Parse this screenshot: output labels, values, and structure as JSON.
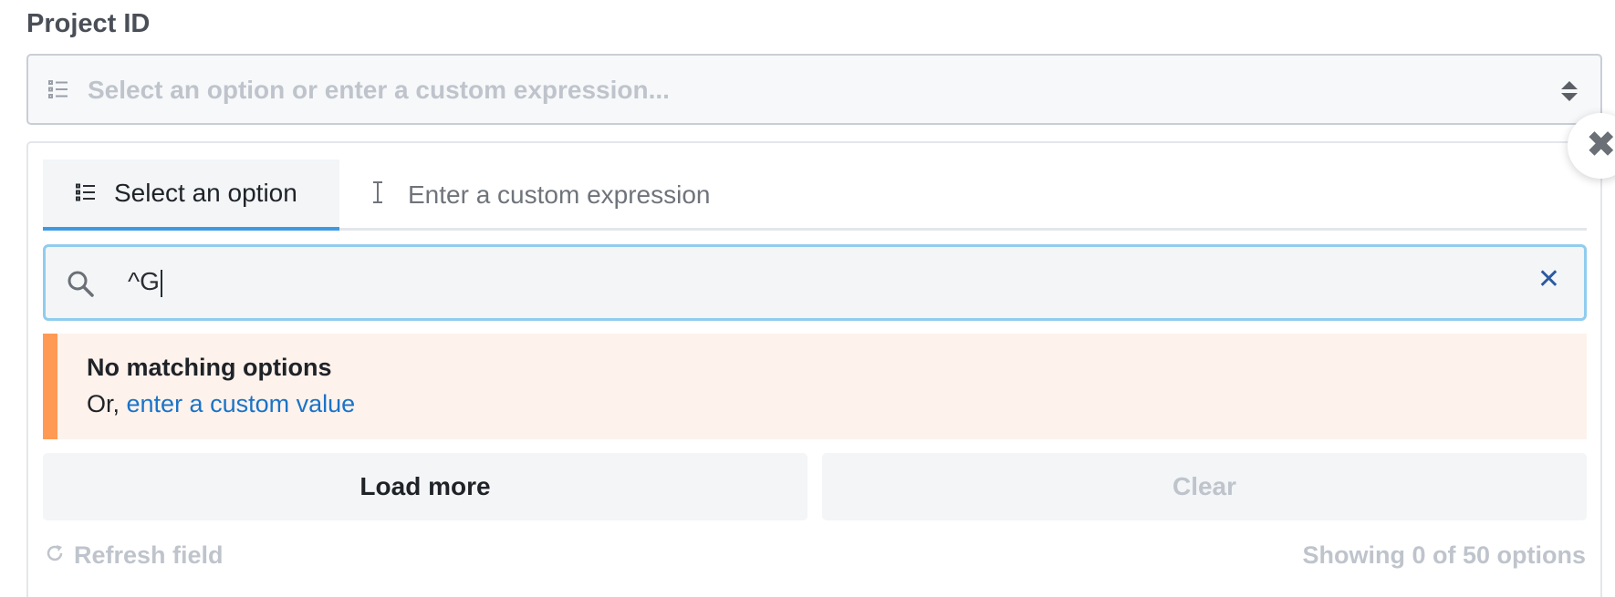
{
  "field": {
    "label": "Project ID",
    "placeholder": "Select an option or enter a custom expression..."
  },
  "tabs": [
    {
      "label": "Select an option",
      "active": true,
      "icon": "list-icon"
    },
    {
      "label": "Enter a custom expression",
      "active": false,
      "icon": "text-cursor-icon"
    }
  ],
  "search": {
    "value": "^G",
    "clear_glyph": "✕"
  },
  "notice": {
    "title": "No matching options",
    "prefix": "Or, ",
    "link": "enter a custom value"
  },
  "buttons": {
    "load_more": "Load more",
    "clear": "Clear"
  },
  "footer": {
    "refresh": "Refresh field",
    "count": "Showing 0 of 50 options"
  },
  "close_glyph": "✖",
  "colors": {
    "accent": "#3d9ae2",
    "warning": "#ff9a54",
    "warning_bg": "#fdf2ec",
    "link": "#1a73c8",
    "muted": "#bfc4cc"
  }
}
